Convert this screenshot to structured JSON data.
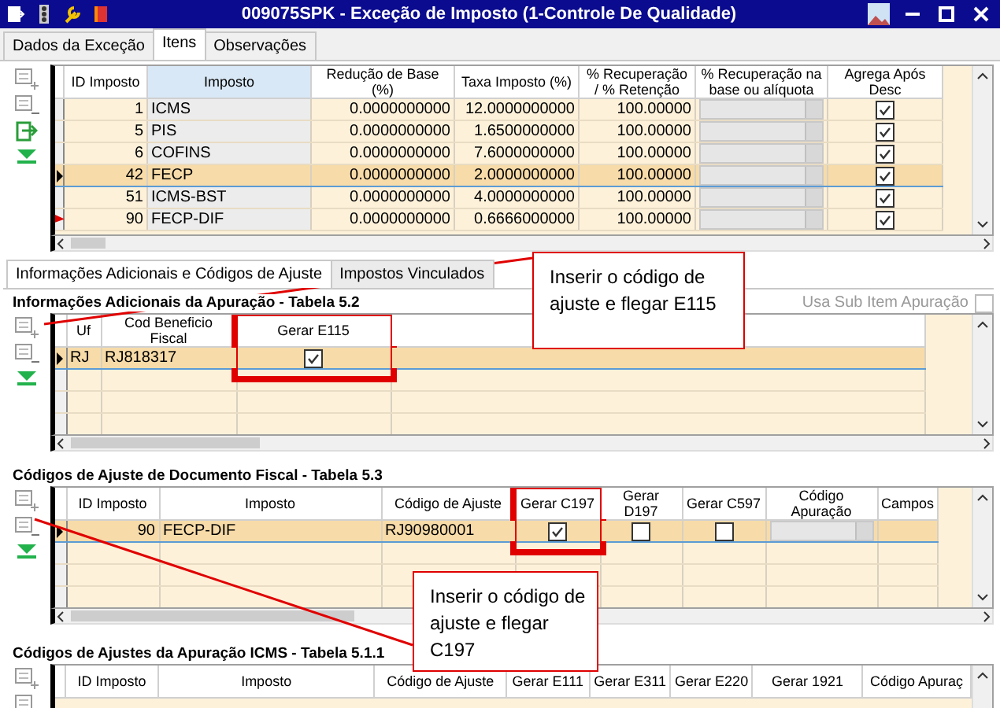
{
  "window": {
    "title": "009075SPK - Exceção de Imposto (1-Controle De Qualidade)"
  },
  "tabs": [
    {
      "label": "Dados da Exceção",
      "selected": false
    },
    {
      "label": "Itens",
      "selected": true
    },
    {
      "label": "Observações",
      "selected": false
    }
  ],
  "items_grid": {
    "columns": [
      {
        "label": "ID Imposto",
        "selected": false
      },
      {
        "label": "Imposto",
        "selected": true
      },
      {
        "label": "Redução de Base (%)",
        "selected": false
      },
      {
        "label": "Taxa Imposto (%)",
        "selected": false
      },
      {
        "label": "% Recuperação / % Retenção",
        "selected": false
      },
      {
        "label": "% Recuperação na base ou alíquota",
        "selected": false
      },
      {
        "label": "Agrega Após Desc",
        "selected": false
      }
    ],
    "rows": [
      {
        "selected": false,
        "arrow": false,
        "cells": [
          {
            "kind": "num",
            "text": "1"
          },
          {
            "kind": "text",
            "text": "ICMS"
          },
          {
            "kind": "num",
            "text": "0.0000000000"
          },
          {
            "kind": "num",
            "text": "12.0000000000"
          },
          {
            "kind": "num",
            "text": "100.00000"
          },
          {
            "kind": "combo"
          },
          {
            "kind": "check",
            "checked": true
          }
        ]
      },
      {
        "selected": false,
        "arrow": false,
        "cells": [
          {
            "kind": "num",
            "text": "5"
          },
          {
            "kind": "text",
            "text": "PIS"
          },
          {
            "kind": "num",
            "text": "0.0000000000"
          },
          {
            "kind": "num",
            "text": "1.6500000000"
          },
          {
            "kind": "num",
            "text": "100.00000"
          },
          {
            "kind": "combo"
          },
          {
            "kind": "check",
            "checked": true
          }
        ]
      },
      {
        "selected": false,
        "arrow": false,
        "cells": [
          {
            "kind": "num",
            "text": "6"
          },
          {
            "kind": "text",
            "text": "COFINS"
          },
          {
            "kind": "num",
            "text": "0.0000000000"
          },
          {
            "kind": "num",
            "text": "7.6000000000"
          },
          {
            "kind": "num",
            "text": "100.00000"
          },
          {
            "kind": "combo"
          },
          {
            "kind": "check",
            "checked": true
          }
        ]
      },
      {
        "selected": true,
        "arrow": false,
        "cells": [
          {
            "kind": "num",
            "text": "42"
          },
          {
            "kind": "text",
            "text": "FECP"
          },
          {
            "kind": "num",
            "text": "0.0000000000"
          },
          {
            "kind": "num",
            "text": "2.0000000000"
          },
          {
            "kind": "num",
            "text": "100.00000"
          },
          {
            "kind": "combo"
          },
          {
            "kind": "check",
            "checked": true
          }
        ]
      },
      {
        "selected": false,
        "arrow": false,
        "cells": [
          {
            "kind": "num",
            "text": "51"
          },
          {
            "kind": "text",
            "text": "ICMS-BST"
          },
          {
            "kind": "num",
            "text": "0.0000000000"
          },
          {
            "kind": "num",
            "text": "4.0000000000"
          },
          {
            "kind": "num",
            "text": "100.00000"
          },
          {
            "kind": "combo"
          },
          {
            "kind": "check",
            "checked": true
          }
        ]
      },
      {
        "selected": false,
        "arrow": true,
        "cells": [
          {
            "kind": "num",
            "text": "90"
          },
          {
            "kind": "text",
            "text": "FECP-DIF"
          },
          {
            "kind": "num",
            "text": "0.0000000000"
          },
          {
            "kind": "num",
            "text": "0.6666000000"
          },
          {
            "kind": "num",
            "text": "100.00000"
          },
          {
            "kind": "combo"
          },
          {
            "kind": "check",
            "checked": true
          }
        ]
      }
    ]
  },
  "sub_tabs": [
    {
      "label": "Informações Adicionais e Códigos de Ajuste",
      "selected": true
    },
    {
      "label": "Impostos Vinculados",
      "selected": false
    }
  ],
  "sections": [
    {
      "title": "Informações Adicionais da Apuração - Tabela 5.2",
      "option": {
        "label": "Usa Sub Item Apuração",
        "checked": false
      },
      "columns": [
        {
          "label": "Uf",
          "highlighted": false
        },
        {
          "label": "Cod Beneficio Fiscal",
          "highlighted": false
        },
        {
          "label": "Gerar E115",
          "highlighted": true
        }
      ],
      "rows": [
        {
          "selected": true,
          "cells": [
            {
              "kind": "text",
              "text": "RJ"
            },
            {
              "kind": "text",
              "text": "RJ818317"
            },
            {
              "kind": "check",
              "checked": true
            }
          ]
        }
      ]
    },
    {
      "title": "Códigos de Ajuste de Documento Fiscal - Tabela 5.3",
      "columns": [
        {
          "label": "ID Imposto",
          "highlighted": false
        },
        {
          "label": "Imposto",
          "highlighted": false
        },
        {
          "label": "Código de Ajuste",
          "highlighted": false
        },
        {
          "label": "Gerar C197",
          "highlighted": true
        },
        {
          "label": "Gerar D197",
          "highlighted": false
        },
        {
          "label": "Gerar C597",
          "highlighted": false
        },
        {
          "label": "Código Apuração",
          "highlighted": false
        },
        {
          "label": "Campos",
          "highlighted": false
        }
      ],
      "rows": [
        {
          "selected": true,
          "cells": [
            {
              "kind": "num",
              "text": "90"
            },
            {
              "kind": "text",
              "text": "FECP-DIF"
            },
            {
              "kind": "text",
              "text": "RJ90980001"
            },
            {
              "kind": "check",
              "checked": true
            },
            {
              "kind": "check",
              "checked": false
            },
            {
              "kind": "check",
              "checked": false
            },
            {
              "kind": "combo"
            },
            {
              "kind": "blank"
            }
          ]
        }
      ]
    },
    {
      "title": "Códigos de Ajustes da Apuração ICMS - Tabela 5.1.1",
      "columns": [
        {
          "label": "ID Imposto",
          "highlighted": false
        },
        {
          "label": "Imposto",
          "highlighted": false
        },
        {
          "label": "Código de Ajuste",
          "highlighted": false
        },
        {
          "label": "Gerar E111",
          "highlighted": false
        },
        {
          "label": "Gerar E311",
          "highlighted": false
        },
        {
          "label": "Gerar E220",
          "highlighted": false
        },
        {
          "label": "Gerar 1921",
          "highlighted": false
        },
        {
          "label": "Código Apuraç",
          "highlighted": false
        }
      ]
    }
  ],
  "callouts": [
    {
      "text": "Inserir o código de ajuste e flegar E115"
    },
    {
      "text": "Inserir o código de ajuste e flegar C197"
    }
  ]
}
